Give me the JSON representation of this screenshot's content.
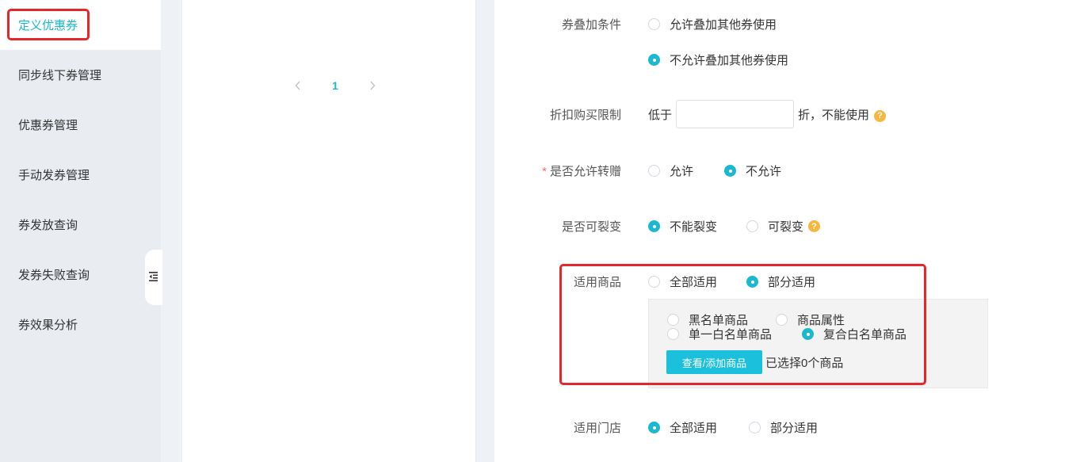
{
  "sidebar": {
    "items": [
      {
        "label": "定义优惠券"
      },
      {
        "label": "同步线下券管理"
      },
      {
        "label": "优惠券管理"
      },
      {
        "label": "手动发券管理"
      },
      {
        "label": "券发放查询"
      },
      {
        "label": "发券失败查询"
      },
      {
        "label": "券效果分析"
      }
    ],
    "active_index": 0
  },
  "pager": {
    "current": "1"
  },
  "form": {
    "stack": {
      "label": "券叠加条件",
      "options": [
        "允许叠加其他券使用",
        "不允许叠加其他券使用"
      ],
      "selected": 1
    },
    "discount_limit": {
      "label": "折扣购买限制",
      "prefix": "低于",
      "value": "",
      "suffix": "折，不能使用"
    },
    "transfer": {
      "label": "是否允许转赠",
      "required_mark": "*",
      "options": [
        "允许",
        "不允许"
      ],
      "selected": 1
    },
    "fission": {
      "label": "是否可裂变",
      "options": [
        "不能裂变",
        "可裂变"
      ],
      "selected": 0
    },
    "goods": {
      "label": "适用商品",
      "options": [
        "全部适用",
        "部分适用"
      ],
      "selected": 1,
      "sub_options": [
        "黑名单商品",
        "商品属性",
        "单一白名单商品",
        "复合白名单商品"
      ],
      "sub_selected": 3,
      "add_button": "查看/添加商品",
      "selected_text": "已选择0个商品"
    },
    "stores": {
      "label": "适用门店",
      "options": [
        "全部适用",
        "部分适用"
      ],
      "selected": 0
    },
    "help_icon": "?"
  },
  "colors": {
    "accent": "#1bb8d0",
    "highlight": "#e5262a",
    "help": "#f7b73e"
  }
}
